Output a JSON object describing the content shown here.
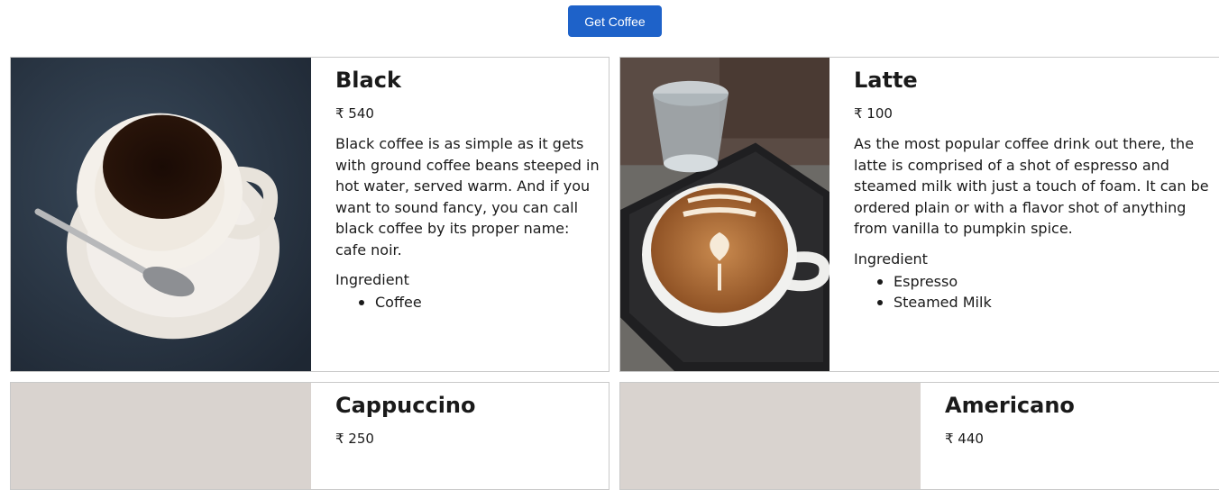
{
  "toolbar": {
    "get_coffee_label": "Get Coffee"
  },
  "currency_symbol": "₹",
  "cards": [
    {
      "title": "Black",
      "price": "₹ 540",
      "description": "Black coffee is as simple as it gets with ground coffee beans steeped in hot water, served warm. And if you want to sound fancy, you can call black coffee by its proper name: cafe noir.",
      "ingredient_label": "Ingredient",
      "ingredients": [
        "Coffee"
      ]
    },
    {
      "title": "Latte",
      "price": "₹ 100",
      "description": "As the most popular coffee drink out there, the latte is comprised of a shot of espresso and steamed milk with just a touch of foam. It can be ordered plain or with a flavor shot of anything from vanilla to pumpkin spice.",
      "ingredient_label": "Ingredient",
      "ingredients": [
        "Espresso",
        "Steamed Milk"
      ]
    },
    {
      "title": "Cappuccino",
      "price": "₹ 250"
    },
    {
      "title": "Americano",
      "price": "₹ 440"
    }
  ],
  "colors": {
    "button_bg": "#1e62c9",
    "card_border": "#c9c9c9",
    "placeholder_image": "#d9d3cf"
  }
}
